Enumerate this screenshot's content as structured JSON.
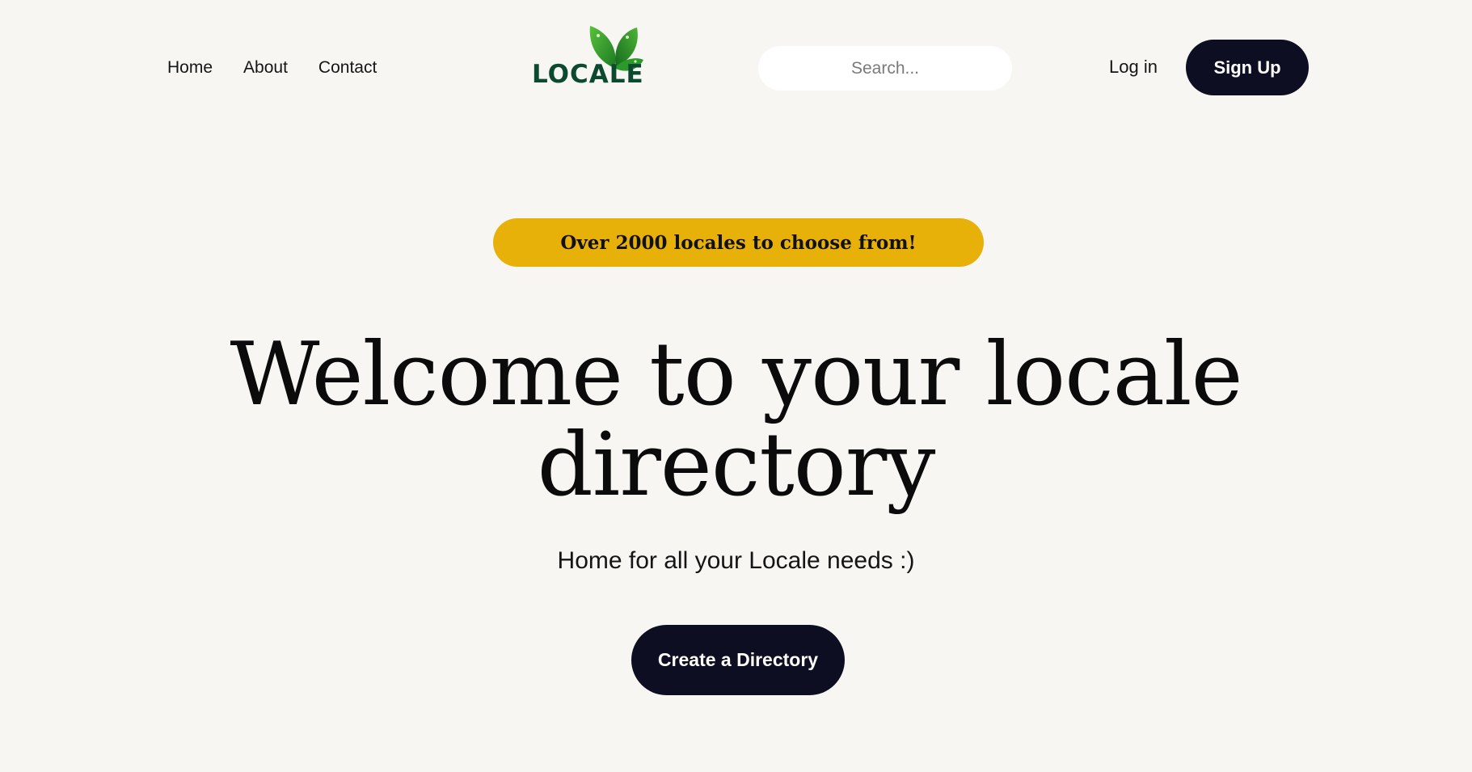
{
  "nav": {
    "links": [
      {
        "label": "Home"
      },
      {
        "label": "About"
      },
      {
        "label": "Contact"
      }
    ]
  },
  "logo": {
    "text": "LOCALE",
    "icon": "leaf-icon",
    "brand_color": "#0b4a2f",
    "leaf_color": "#2e9e2b"
  },
  "search": {
    "placeholder": "Search...",
    "value": ""
  },
  "auth": {
    "login_label": "Log in",
    "signup_label": "Sign Up"
  },
  "hero": {
    "badge": "Over 2000 locales to choose from!",
    "title_line1": "Welcome to your locale",
    "title_line2": "directory",
    "subtitle": "Home for all your Locale needs :)",
    "cta_label": "Create a Directory"
  },
  "colors": {
    "background": "#f7f6f3",
    "dark_button": "#0e0e22",
    "badge": "#e8b10a"
  }
}
